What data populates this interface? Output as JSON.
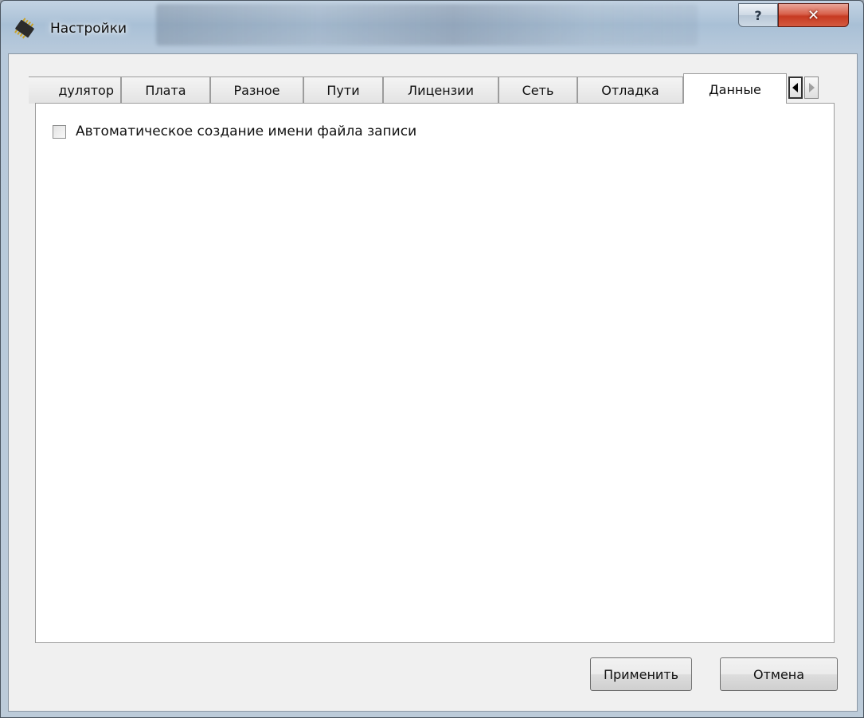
{
  "window": {
    "title": "Настройки",
    "help_glyph": "?",
    "close_glyph": "✕"
  },
  "tabs": [
    {
      "label": "дулятор",
      "active": false
    },
    {
      "label": "Плата",
      "active": false
    },
    {
      "label": "Разное",
      "active": false
    },
    {
      "label": "Пути",
      "active": false
    },
    {
      "label": "Лицензии",
      "active": false
    },
    {
      "label": "Сеть",
      "active": false
    },
    {
      "label": "Отладка",
      "active": false
    },
    {
      "label": "Данные",
      "active": true
    }
  ],
  "tab_scroll": {
    "left_icon": "triangle-left-icon",
    "right_icon": "triangle-right-icon"
  },
  "panel": {
    "auto_filename": {
      "label": "Автоматическое создание имени файла записи",
      "checked": false
    }
  },
  "buttons": {
    "apply": "Применить",
    "cancel": "Отмена"
  },
  "colors": {
    "close_red": "#c73a22",
    "frame_blue": "#a9c0d6"
  }
}
